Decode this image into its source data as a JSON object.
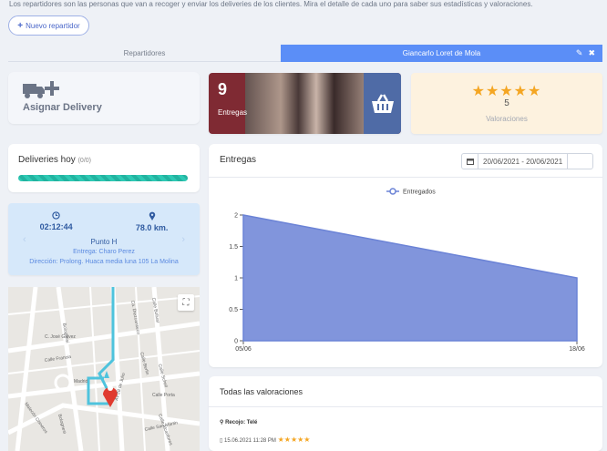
{
  "intro": "Los repartidores son las personas que van a recoger y enviar los deliveries de los clientes. Mira el detalle de cada uno para saber sus estadísticas y valoraciones.",
  "new_button": "Nuevo repartidor",
  "tabs": [
    {
      "label": "Repartidores",
      "active": false
    },
    {
      "label": "Giancarlo Loret de Mola",
      "active": true
    }
  ],
  "assign": {
    "label": "Asignar Delivery",
    "icon": "truck-plus-icon"
  },
  "entregas_stat": {
    "value": "9",
    "label": "Entregas",
    "icon": "basket-icon"
  },
  "valoraciones_stat": {
    "value": "5",
    "label": "Valoraciones",
    "stars": 5
  },
  "deliveries_hoy": {
    "title": "Deliveries hoy",
    "count": "(0/0)",
    "progress": 1.0
  },
  "punto": {
    "time": "02:12:44",
    "distance": "78.0 km.",
    "name": "Punto H",
    "entrega": "Entrega: Charo Perez",
    "direccion": "Dirección: Prolong. Huaca media luna 105 La Molina"
  },
  "map": {
    "streets": [
      "Bolognesi",
      "Ca. Diezcanseco",
      "Calle Bolivar",
      "C. José Gálvez",
      "Calle Francia",
      "Calle Berlin",
      "Calle Schell",
      "Madrid",
      "Malecón Cisneros",
      "Bolognesi",
      "Av 28 de Julio",
      "Calle San Martin",
      "Calle Alcanfores",
      "Calle Porta"
    ]
  },
  "chart": {
    "title": "Entregas",
    "date_range": "20/06/2021 - 20/06/2021"
  },
  "chart_data": {
    "type": "area",
    "x": [
      "05/06",
      "18/06"
    ],
    "series": [
      {
        "name": "Entregados",
        "values": [
          2,
          1
        ],
        "color": "#6b83d6"
      }
    ],
    "yticks": [
      "0",
      "0.5",
      "1",
      "1.5",
      "2"
    ],
    "ylim": [
      0,
      2
    ],
    "legend": "top-center",
    "grid": false
  },
  "valoraciones_list": {
    "title": "Todas las valoraciones",
    "item": {
      "recojo": "Recojo: Telé",
      "date": "15.06.2021 11:28 PM",
      "stars": 5
    }
  }
}
